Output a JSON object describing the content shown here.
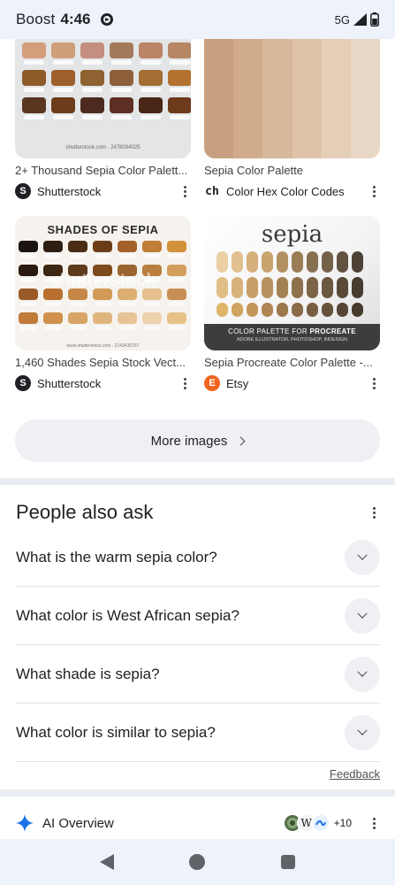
{
  "status_bar": {
    "carrier": "Boost",
    "time": "4:46",
    "network": "5G"
  },
  "images": [
    {
      "caption": "2+ Thousand Sepia Color Palett...",
      "source": "Shutterstock",
      "source_icon_letter": "S",
      "watermark": "shutterstock.com · 2478034025"
    },
    {
      "caption": "Sepia Color Palette",
      "source": "Color Hex Color Codes",
      "source_icon_letter": "ch"
    },
    {
      "caption": "1,460 Shades Sepia Stock Vect...",
      "source": "Shutterstock",
      "source_icon_letter": "S",
      "image_title": "SHADES OF SEPIA",
      "watermark": "shutterstock",
      "small_print": "www.shutterstock.com · 2143430767"
    },
    {
      "caption": "Sepia Procreate Color Palette -...",
      "source": "Etsy",
      "source_icon_letter": "E",
      "image_title": "sepia",
      "banner_line1_a": "COLOR PALETTE FOR ",
      "banner_line1_b": "PROCREATE",
      "banner_line2": "ADOBE ILLUSTRATOR, PHOTOSHOP, INDESIGN"
    }
  ],
  "more_images_label": "More images",
  "people_also_ask": {
    "title": "People also ask",
    "questions": [
      "What is the warm sepia color?",
      "What color is West African sepia?",
      "What shade is sepia?",
      "What color is similar to sepia?"
    ]
  },
  "feedback_label": "Feedback",
  "ai_overview": {
    "label": "AI Overview",
    "extra_sources": "+10"
  },
  "colors": {
    "accent_blue": "#1a73e8",
    "shutterstock_icon": "#202124",
    "etsy_icon": "#f1641e"
  }
}
